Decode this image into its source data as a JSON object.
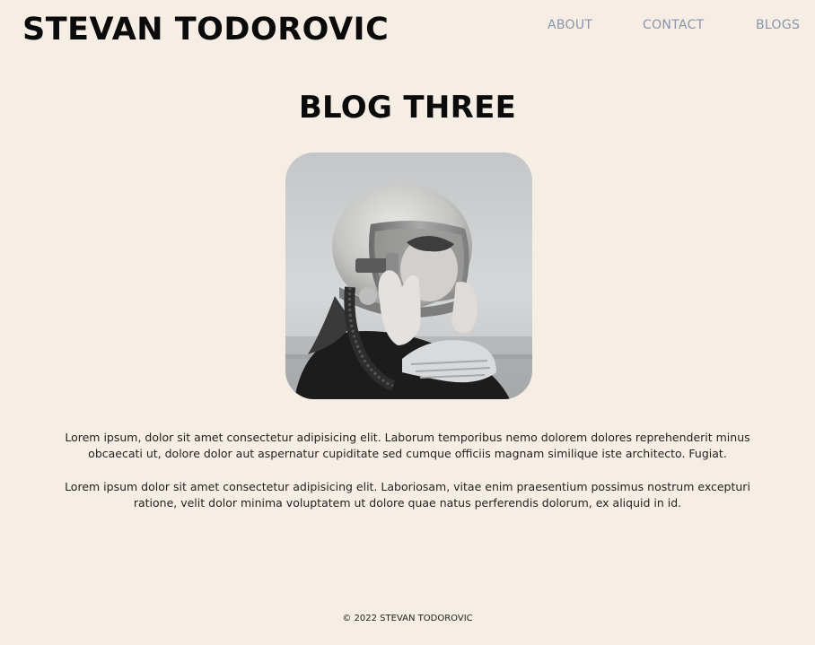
{
  "header": {
    "brand": "STEVAN TODOROVIC",
    "nav": {
      "about": "ABOUT",
      "contact": "CONTACT",
      "blogs": "BLOGS"
    }
  },
  "post": {
    "title": "BLOG THREE",
    "image": {
      "alt": "Black and white photo of a girl wearing a vintage space helmet",
      "icon": "photo"
    },
    "paragraphs": [
      "Lorem ipsum, dolor sit amet consectetur adipisicing elit. Laborum temporibus nemo dolorem dolores reprehenderit minus obcaecati ut, dolore dolor aut aspernatur cupiditate sed cumque officiis magnam similique iste architecto. Fugiat.",
      "Lorem ipsum dolor sit amet consectetur adipisicing elit. Laboriosam, vitae enim praesentium possimus nostrum excepturi ratione, velit dolor minima voluptatem ut dolore quae natus perferendis dolorum, ex aliquid in id."
    ]
  },
  "footer": {
    "copyright": "© 2022 STEVAN TODOROVIC"
  },
  "colors": {
    "background": "#f6ede4",
    "text": "#0b0b0b",
    "nav": "#8a94ad"
  }
}
